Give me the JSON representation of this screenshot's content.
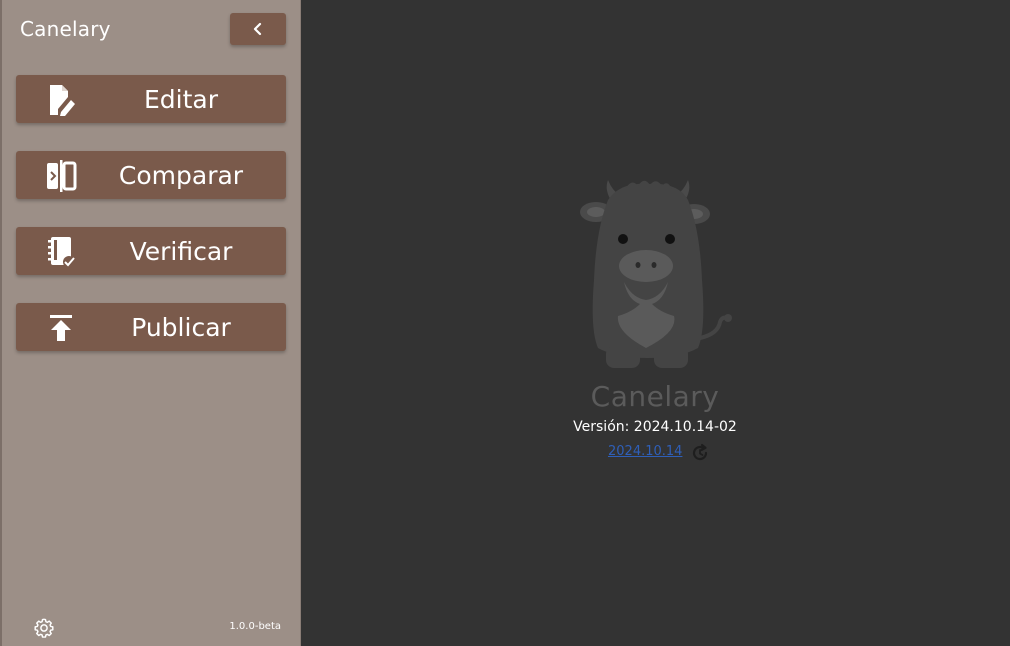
{
  "sidebar": {
    "title": "Canelary",
    "collapse_icon": "chevron-left-icon",
    "items": [
      {
        "label": "Editar",
        "icon": "edit-document-icon"
      },
      {
        "label": "Comparar",
        "icon": "compare-icon"
      },
      {
        "label": "Verificar",
        "icon": "verify-notebook-icon"
      },
      {
        "label": "Publicar",
        "icon": "upload-icon"
      }
    ],
    "settings_icon": "gear-icon",
    "version": "1.0.0-beta"
  },
  "main": {
    "logo": "cow-mascot-logo",
    "app_name": "Canelary",
    "version_text": "Versión: 2024.10.14-02",
    "update_link": "2024.10.14",
    "update_icon": "refresh-icon"
  },
  "colors": {
    "sidebar_bg": "#9c8f87",
    "button_bg": "#7a5a4b",
    "main_bg": "#333333",
    "link": "#2f5fb8"
  }
}
